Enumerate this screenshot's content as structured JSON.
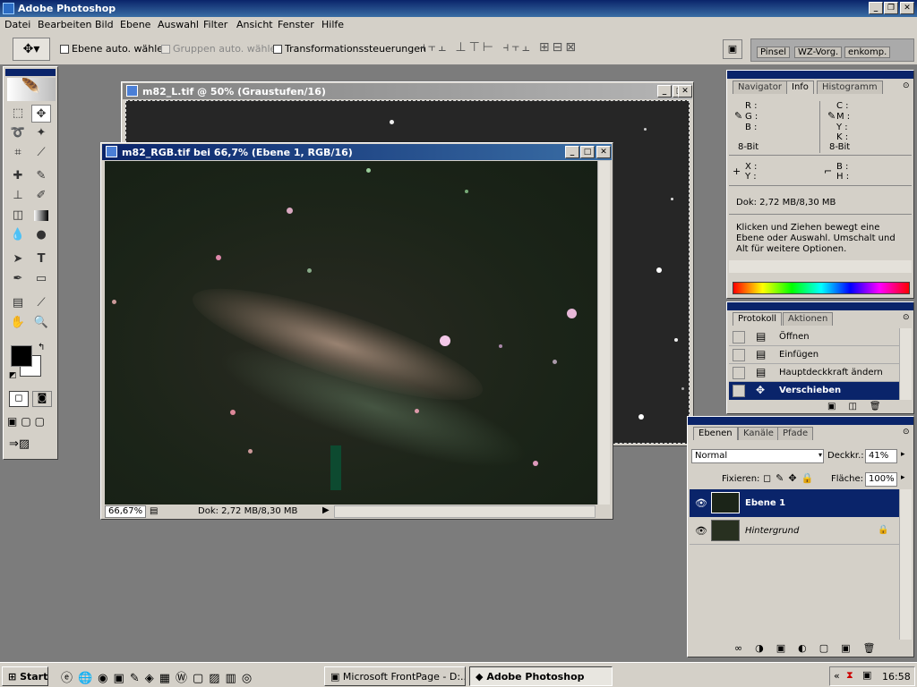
{
  "app": {
    "title": "Adobe Photoshop"
  },
  "menu": [
    "Datei",
    "Bearbeiten",
    "Bild",
    "Ebene",
    "Auswahl",
    "Filter",
    "Ansicht",
    "Fenster",
    "Hilfe"
  ],
  "options": {
    "auto_layer": "Ebene auto. wählen",
    "auto_group": "Gruppen auto. wählen",
    "transform": "Transformationssteuerungen",
    "well_tabs": [
      "Pinsel",
      "WZ-Vorg.",
      "enkomp."
    ]
  },
  "doc_back": {
    "title": "m82_L.tif @ 50% (Graustufen/16)"
  },
  "doc_front": {
    "title": "m82_RGB.tif bei 66,7% (Ebene 1, RGB/16)",
    "zoom": "66,67%",
    "doc_info": "Dok: 2,72 MB/8,30 MB"
  },
  "info_palette": {
    "tabs": [
      "Navigator",
      "Info",
      "Histogramm"
    ],
    "r": "R :",
    "g": "G :",
    "b": "B :",
    "c": "C :",
    "m": "M :",
    "y": "Y :",
    "k": "K :",
    "bits_left": "8-Bit",
    "bits_right": "8-Bit",
    "x": "X :",
    "y2": "Y :",
    "w": "B :",
    "h": "H :",
    "doc": "Dok: 2,72 MB/8,30 MB",
    "hint": "Klicken und Ziehen bewegt eine Ebene oder Auswahl. Umschalt und Alt für weitere Optionen."
  },
  "history": {
    "tabs": [
      "Protokoll",
      "Aktionen"
    ],
    "items": [
      "Öffnen",
      "Einfügen",
      "Hauptdeckkraft ändern",
      "Verschieben"
    ]
  },
  "layers": {
    "tabs": [
      "Ebenen",
      "Kanäle",
      "Pfade"
    ],
    "blend": "Normal",
    "opacity_label": "Deckkr.:",
    "opacity": "41%",
    "lock_label": "Fixieren:",
    "fill_label": "Fläche:",
    "fill": "100%",
    "items": [
      "Ebene 1",
      "Hintergrund"
    ]
  },
  "taskbar": {
    "start": "Start",
    "tasks": [
      "Microsoft FrontPage - D:...",
      "Adobe Photoshop"
    ],
    "time": "16:58"
  },
  "colors": {
    "title_blue": "#0a246a",
    "selected": "#0a246a"
  }
}
